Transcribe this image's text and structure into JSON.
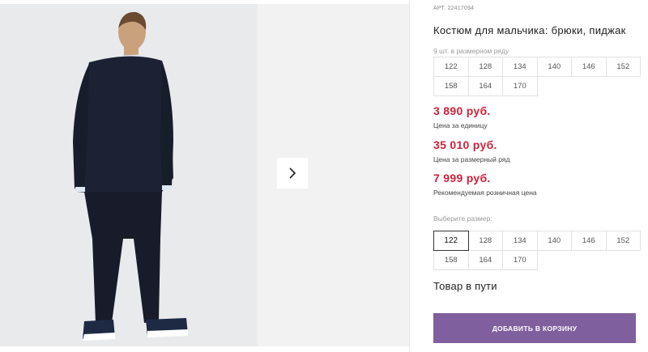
{
  "product": {
    "article_label": "АРТ.",
    "article_value": "22417094",
    "title": "Костюм для мальчика: брюки, пиджак",
    "range_label": "9 шт. в размерном ряду",
    "range_sizes": [
      "122",
      "128",
      "134",
      "140",
      "146",
      "152",
      "158",
      "164",
      "170"
    ],
    "prices": [
      {
        "value": "3 890 руб.",
        "note": "Цена за единицу"
      },
      {
        "value": "35 010 руб.",
        "note": "Цена за размерный ряд"
      },
      {
        "value": "7 999 руб.",
        "note": "Рекомендуемая розничная цена"
      }
    ],
    "choose_size_label": "Выберите размер:",
    "selectable_sizes": [
      "122",
      "128",
      "134",
      "140",
      "146",
      "152",
      "158",
      "164",
      "170"
    ],
    "selected_size": "122",
    "stock_status": "Товар в пути",
    "add_to_cart_label": "ДОБАВИТЬ В КОРЗИНУ"
  },
  "gallery": {
    "next_icon": "chevron-right-icon"
  },
  "colors": {
    "price": "#d0213a",
    "cart_button": "#7f5f9d",
    "suit": "#1c2233"
  }
}
